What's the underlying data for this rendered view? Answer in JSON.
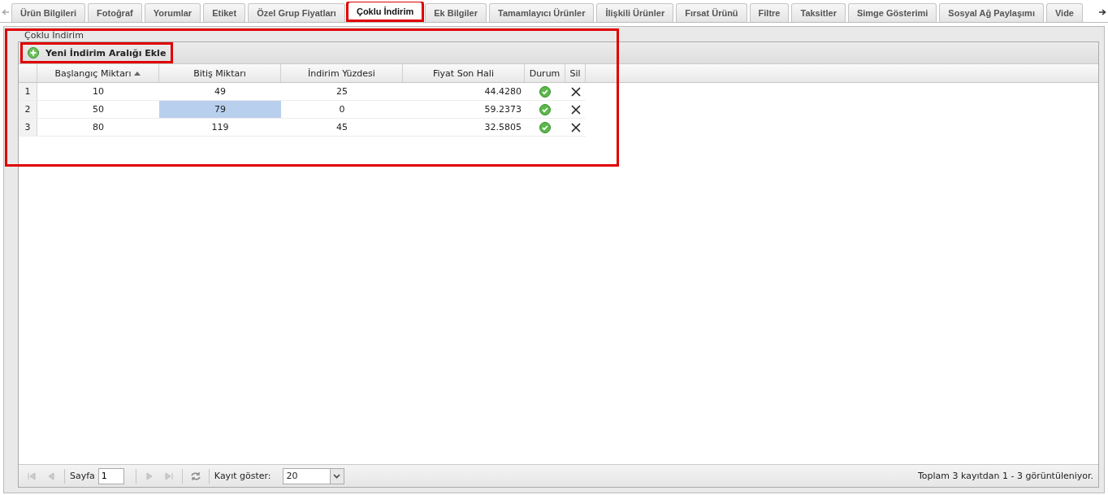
{
  "tabs": [
    {
      "label": "Ürün Bilgileri",
      "selected": false
    },
    {
      "label": "Fotoğraf",
      "selected": false
    },
    {
      "label": "Yorumlar",
      "selected": false
    },
    {
      "label": "Etiket",
      "selected": false
    },
    {
      "label": "Özel Grup Fiyatları",
      "selected": false
    },
    {
      "label": "Çoklu İndirim",
      "selected": true
    },
    {
      "label": "Ek Bilgiler",
      "selected": false
    },
    {
      "label": "Tamamlayıcı Ürünler",
      "selected": false
    },
    {
      "label": "İlişkili Ürünler",
      "selected": false
    },
    {
      "label": "Fırsat Ürünü",
      "selected": false
    },
    {
      "label": "Filtre",
      "selected": false
    },
    {
      "label": "Taksitler",
      "selected": false
    },
    {
      "label": "Simge Gösterimi",
      "selected": false
    },
    {
      "label": "Sosyal Ağ Paylaşımı",
      "selected": false
    },
    {
      "label": "Vide",
      "selected": false
    }
  ],
  "fieldset": {
    "legend": "Çoklu İndirim",
    "highlighted": true
  },
  "toolbar": {
    "add_button": "Yeni İndirim Aralığı Ekle",
    "highlighted": true
  },
  "table": {
    "columns": [
      {
        "label": "Başlangıç Miktarı",
        "sorted": true
      },
      {
        "label": "Bitiş Miktarı",
        "sorted": false
      },
      {
        "label": "İndirim Yüzdesi",
        "sorted": false
      },
      {
        "label": "Fiyat Son Hali",
        "sorted": false
      },
      {
        "label": "Durum",
        "sorted": false
      },
      {
        "label": "Sil",
        "sorted": false
      }
    ],
    "rows": [
      {
        "number": "1",
        "cells": [
          {
            "text": "10",
            "selected": false
          },
          {
            "text": "49",
            "selected": false
          },
          {
            "text": "25",
            "selected": false
          },
          {
            "text": "44.4280",
            "selected": false
          }
        ],
        "active": true
      },
      {
        "number": "2",
        "cells": [
          {
            "text": "50",
            "selected": false
          },
          {
            "text": "79",
            "selected": true
          },
          {
            "text": "0",
            "selected": false
          },
          {
            "text": "59.2373",
            "selected": false
          }
        ],
        "active": true
      },
      {
        "number": "3",
        "cells": [
          {
            "text": "80",
            "selected": false
          },
          {
            "text": "119",
            "selected": false
          },
          {
            "text": "45",
            "selected": false
          },
          {
            "text": "32.5805",
            "selected": false
          }
        ],
        "active": true
      }
    ]
  },
  "paging": {
    "page_label": "Sayfa",
    "page": "1",
    "page_size_label": "Kayıt göster:",
    "page_size": "20",
    "summary": "Toplam 3 kayıtdan 1 - 3 görüntüleniyor."
  }
}
